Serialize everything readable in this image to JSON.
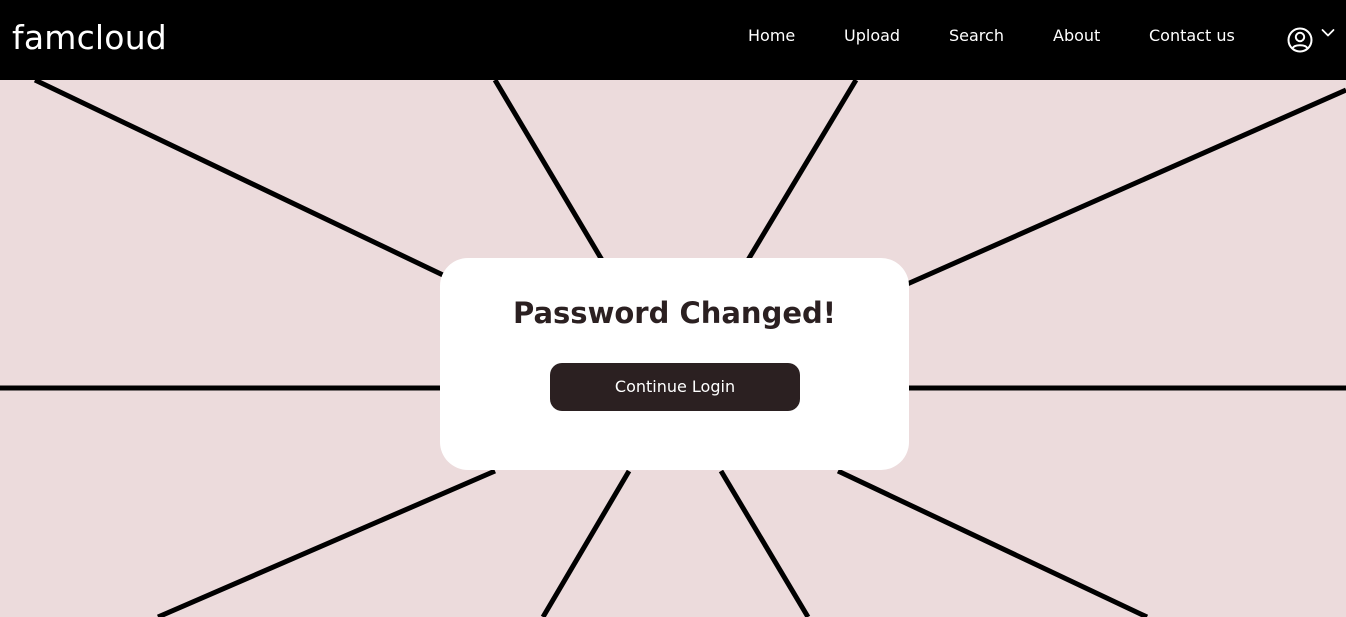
{
  "brand": "famcloud",
  "nav": {
    "items": [
      {
        "label": "Home"
      },
      {
        "label": "Upload"
      },
      {
        "label": "Search"
      },
      {
        "label": "About"
      },
      {
        "label": "Contact us"
      }
    ],
    "account_icon": "user-circle-icon",
    "account_menu_icon": "chevron-down-icon"
  },
  "dialog": {
    "title": "Password Changed!",
    "button_label": "Continue Login"
  },
  "colors": {
    "nav_background": "#000000",
    "page_background": "#ecdbdc",
    "card_background": "#ffffff",
    "text_dark": "#2b2021",
    "button_background": "#2b2021",
    "button_text": "#ffffff",
    "ray_color": "#000000"
  }
}
